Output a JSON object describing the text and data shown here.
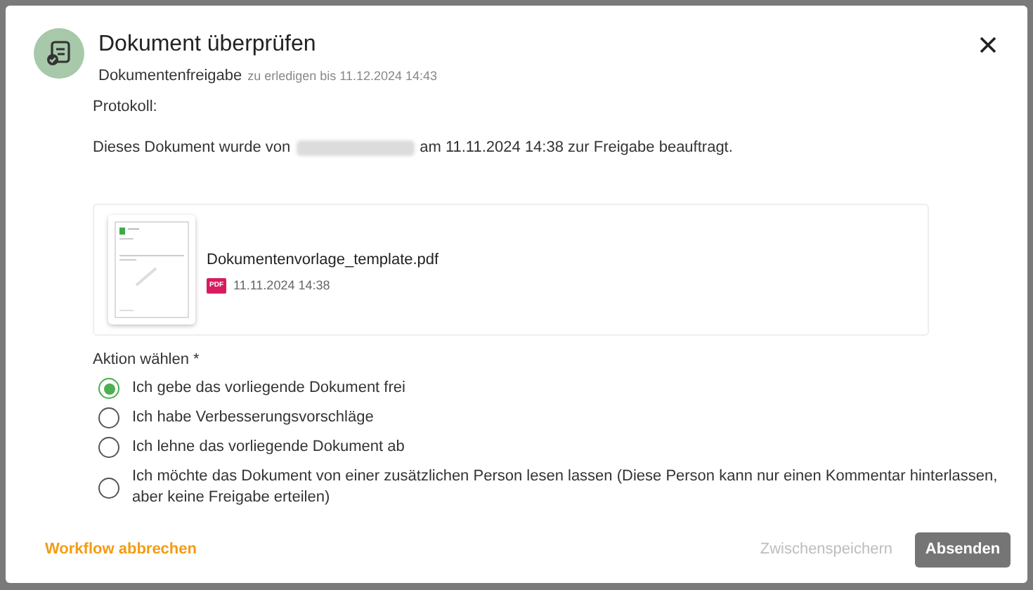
{
  "dialog": {
    "title": "Dokument überprüfen",
    "subtitle": "Dokumentenfreigabe",
    "due": "zu erledigen bis 11.12.2024 14:43"
  },
  "protocol": {
    "label": "Protokoll:",
    "text_before": "Dieses Dokument wurde von",
    "name_redacted": true,
    "text_after": "am 11.11.2024 14:38 zur Freigabe beauftragt."
  },
  "attachment": {
    "file_name": "Dokumentenvorlage_template.pdf",
    "file_type": "PDF",
    "date": "11.11.2024 14:38"
  },
  "action": {
    "label": "Aktion wählen *",
    "options": [
      {
        "label": "Ich gebe das vorliegende Dokument frei",
        "selected": true
      },
      {
        "label": "Ich habe Verbesserungsvorschläge",
        "selected": false
      },
      {
        "label": "Ich lehne das vorliegende Dokument ab",
        "selected": false
      },
      {
        "label": "Ich möchte das Dokument von einer zusätzlichen Person lesen lassen (Diese Person kann nur einen Kommentar hinterlassen, aber keine Freigabe erteilen)",
        "selected": false
      }
    ]
  },
  "footer": {
    "cancel": "Workflow abbrechen",
    "save": "Zwischenspeichern",
    "submit": "Absenden"
  }
}
